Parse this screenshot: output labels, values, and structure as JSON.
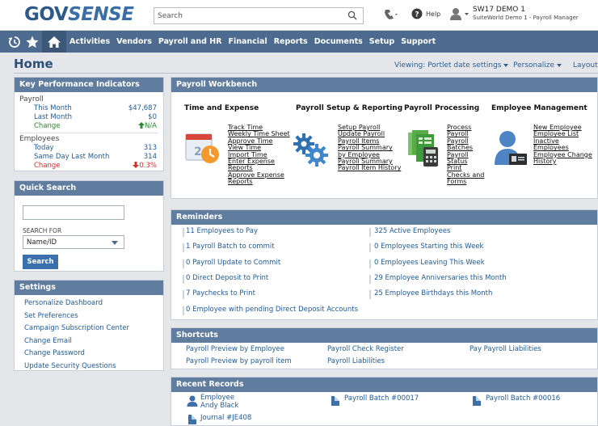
{
  "brand": {
    "gov": "GOV",
    "sense": "SENSE"
  },
  "header": {
    "search_placeholder": "Search",
    "help_label": "Help",
    "user_name": "SW17 DEMO 1",
    "user_role": "SuiteWorld Demo 1 - Payroll Manager"
  },
  "nav": {
    "items": [
      "Activities",
      "Vendors",
      "Payroll and HR",
      "Financial",
      "Reports",
      "Documents",
      "Setup",
      "Support"
    ]
  },
  "page": {
    "title": "Home",
    "viewing": "Viewing: Portlet date settings",
    "personalize": "Personalize",
    "layout": "Layout"
  },
  "kpi": {
    "title": "Key Performance Indicators",
    "payroll_label": "Payroll",
    "payroll": [
      {
        "label": "This Month",
        "value": "$47,687"
      },
      {
        "label": "Last Month",
        "value": "$0"
      },
      {
        "label": "Change",
        "value": "N/A"
      }
    ],
    "employees_label": "Employees",
    "employees": [
      {
        "label": "Today",
        "value": "313"
      },
      {
        "label": "Same Day Last Month",
        "value": "314"
      },
      {
        "label": "Change",
        "value": "0.3%"
      }
    ]
  },
  "quick_search": {
    "title": "Quick Search",
    "search_for_label": "SEARCH FOR",
    "selected": "Name/ID",
    "button": "Search"
  },
  "settings": {
    "title": "Settings",
    "items": [
      "Personalize Dashboard",
      "Set Preferences",
      "Campaign Subscription Center",
      "Change Email",
      "Change Password",
      "Update Security Questions"
    ]
  },
  "workbench": {
    "title": "Payroll Workbench",
    "columns": [
      {
        "title": "Time and Expense",
        "links": [
          "Track Time",
          "Weekly Time Sheet",
          "Approve Time",
          "View Time",
          "Import Time",
          "Enter Expense",
          "Reports",
          "Approve Expense",
          "Reports"
        ]
      },
      {
        "title": "Payroll Setup & Reporting",
        "links": [
          "Setup Payroll",
          "Update Payroll",
          "Payroll Items",
          "Payroll Summary",
          "by Employee",
          "Payroll Summary",
          "Payroll Item History"
        ]
      },
      {
        "title": "Payroll Processing",
        "links": [
          "Process",
          "Payroll",
          "Payroll",
          "Batches",
          "Payroll",
          "Status",
          "Print",
          "Checks and",
          "Forms"
        ]
      },
      {
        "title": "Employee Management",
        "links": [
          "New Employee",
          "Employee List",
          "Inactive",
          "Employees",
          "Employee Change",
          "History"
        ]
      }
    ]
  },
  "reminders": {
    "title": "Reminders",
    "left": [
      {
        "num": "11",
        "text": "Employees to Pay"
      },
      {
        "num": "1",
        "text": "Payroll Batch to commit"
      },
      {
        "num": "0",
        "text": "Payroll Update to Commit"
      },
      {
        "num": "0",
        "text": "Direct Deposit to Print"
      },
      {
        "num": "7",
        "text": "Paychecks to Print"
      },
      {
        "num": "0",
        "text": "Employee with pending Direct Deposit Accounts"
      }
    ],
    "right": [
      {
        "num": "325",
        "text": "Active Employees"
      },
      {
        "num": "0",
        "text": "Employees Starting this Week"
      },
      {
        "num": "0",
        "text": "Employees Leaving This Week"
      },
      {
        "num": "29",
        "text": "Employee Anniversaries this Month"
      },
      {
        "num": "25",
        "text": "Employee Birthdays this Month"
      }
    ]
  },
  "shortcuts": {
    "title": "Shortcuts",
    "items": [
      "Payroll Preview by Employee",
      "Payroll Check Register",
      "Pay Payroll Liabilities",
      "Payroll Preview by payroll item",
      "Payroll Liabilities"
    ]
  },
  "recent": {
    "title": "Recent Records",
    "items": [
      {
        "type": "Employee",
        "name": "Andy Black"
      },
      {
        "name": "Payroll Batch #00017"
      },
      {
        "name": "Payroll Batch #00016"
      },
      {
        "name": "Journal #JE408"
      }
    ]
  }
}
